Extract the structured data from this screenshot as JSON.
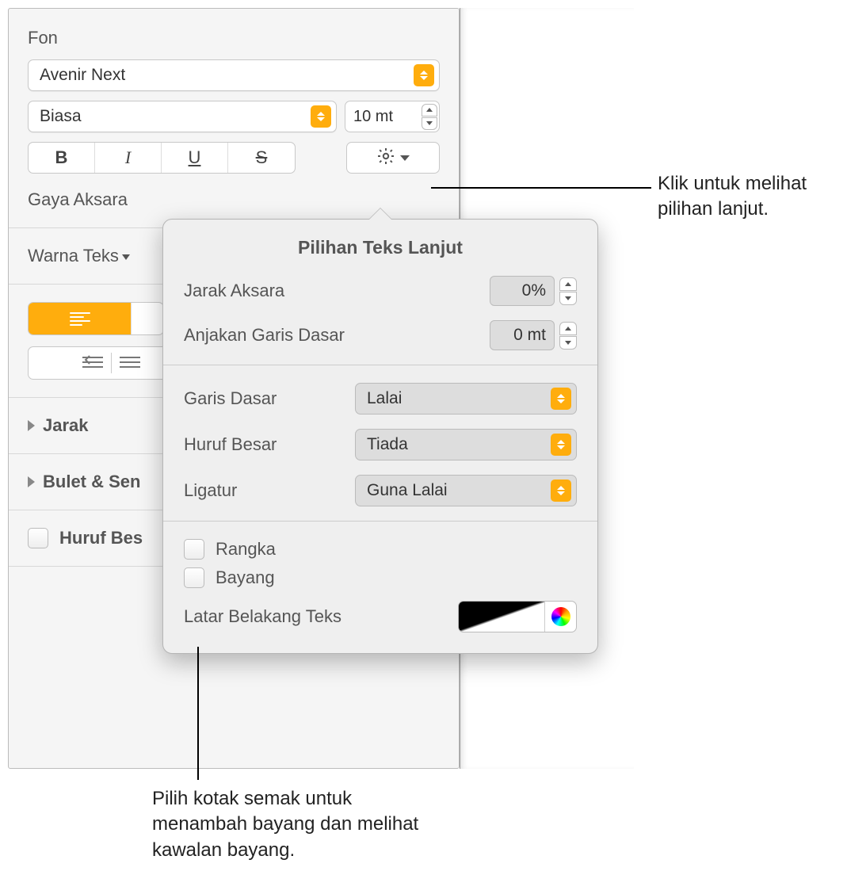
{
  "panel": {
    "font_section_title": "Fon",
    "font_family": "Avenir Next",
    "font_style": "Biasa",
    "font_size": "10 mt",
    "char_style_label": "Gaya Aksara",
    "text_color_label": "Warna Teks",
    "disclosure_spacing": "Jarak",
    "disclosure_bullets": "Bulet & Sen",
    "caps_label": "Huruf Bes"
  },
  "popover": {
    "title": "Pilihan Teks Lanjut",
    "char_spacing_label": "Jarak Aksara",
    "char_spacing_value": "0%",
    "baseline_shift_label": "Anjakan Garis Dasar",
    "baseline_shift_value": "0 mt",
    "baseline_label": "Garis Dasar",
    "baseline_value": "Lalai",
    "caps_label": "Huruf Besar",
    "caps_value": "Tiada",
    "ligature_label": "Ligatur",
    "ligature_value": "Guna Lalai",
    "outline_label": "Rangka",
    "shadow_label": "Bayang",
    "textbg_label": "Latar Belakang Teks"
  },
  "callouts": {
    "gear": "Klik untuk melihat pilihan lanjut.",
    "shadow": "Pilih kotak semak untuk menambah bayang dan melihat kawalan bayang."
  }
}
